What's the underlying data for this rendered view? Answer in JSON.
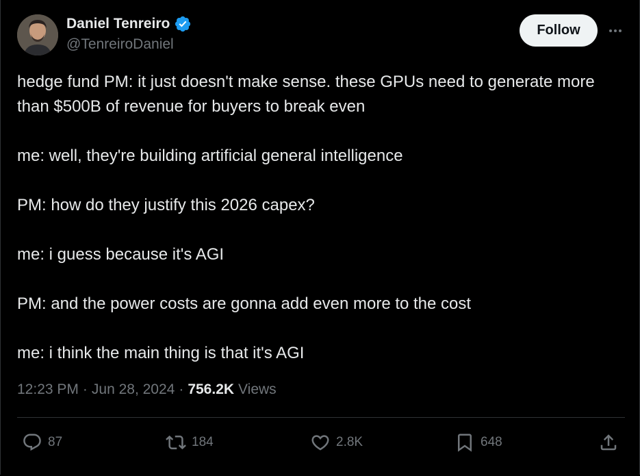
{
  "author": {
    "name": "Daniel Tenreiro",
    "handle": "@TenreiroDaniel",
    "verified_icon": "verified-badge-icon",
    "avatar": "avatar"
  },
  "actions": {
    "follow_label": "Follow",
    "more_icon": "more-icon"
  },
  "tweet": {
    "lines": [
      "hedge fund PM: it just doesn't make sense. these GPUs need to generate more than $500B of revenue for buyers to break even",
      "me: well, they're building artificial general intelligence",
      "PM: how do they justify this 2026 capex?",
      "me: i guess because it's AGI",
      "PM: and the power costs are gonna add even more to the cost",
      "me: i think the main thing is that it's AGI"
    ]
  },
  "meta": {
    "time": "12:23 PM",
    "separator": "·",
    "date": "Jun 28, 2024",
    "views_count": "756.2K",
    "views_label": "Views"
  },
  "engagement": {
    "replies": "87",
    "reposts": "184",
    "likes": "2.8K",
    "bookmarks": "648"
  },
  "colors": {
    "background": "#000000",
    "text": "#e7e9ea",
    "secondary_text": "#71767b",
    "verified": "#1d9bf0",
    "follow_bg": "#eff3f4",
    "divider": "#2f3336"
  }
}
